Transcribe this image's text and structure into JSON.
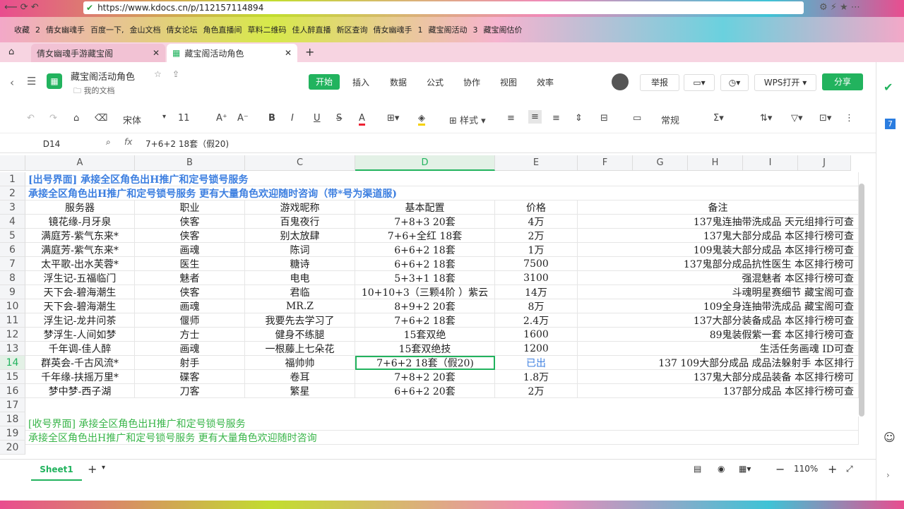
{
  "browser": {
    "url": "https://www.kdocs.cn/p/112157114894",
    "bookmarks": [
      "收藏",
      "2",
      "倩女幽魂手",
      "百度一下,",
      "金山文档",
      "倩女论坛",
      "角色直播间",
      "草料二维码",
      "佳人醉直播",
      "新区查询",
      "倩女幽魂手",
      "1",
      "藏宝阁活动",
      "3",
      "藏宝阁估价"
    ],
    "tabs": [
      {
        "label": "倩女幽魂手游藏宝阁",
        "active": false
      },
      {
        "label": "藏宝阁活动角色",
        "active": true
      }
    ]
  },
  "doc": {
    "title": "藏宝阁活动角色",
    "folder": "我的文档",
    "menu": [
      "开始",
      "插入",
      "数据",
      "公式",
      "协作",
      "视图",
      "效率"
    ],
    "active_menu": "开始",
    "report": "举报",
    "wps_open": "WPS打开",
    "share": "分享"
  },
  "format_toolbar": {
    "font": "宋体",
    "size": "11",
    "style_label": "样式",
    "number_format": "常规"
  },
  "formula_bar": {
    "cell_ref": "D14",
    "fx": "fx",
    "content": "7+6+2 18套（假20)"
  },
  "columns": [
    "A",
    "B",
    "C",
    "D",
    "E",
    "F",
    "G",
    "H",
    "I",
    "J"
  ],
  "rows": [
    "1",
    "2",
    "3",
    "4",
    "5",
    "6",
    "7",
    "8",
    "9",
    "10",
    "11",
    "12",
    "13",
    "14",
    "15",
    "16",
    "17",
    "18",
    "19",
    "20"
  ],
  "sheet": {
    "r1": "[出号界面] 承接全区角色出H推广和定号锁号服务",
    "r2": "承接全区角色出H推广和定号锁号服务 更有大量角色欢迎随时咨询（带*号为渠道服)",
    "header": {
      "a": "服务器",
      "b": "职业",
      "c": "游戏昵称",
      "d": "基本配置",
      "e": "价格",
      "note": "备注"
    },
    "data": [
      {
        "a": "镜花缘-月牙泉",
        "b": "侠客",
        "c": "百鬼夜行",
        "d": "7+8+3 20套",
        "e": "4万",
        "note": "137鬼连抽带洗成品 天元组排行可查"
      },
      {
        "a": "满庭芳-紫气东来*",
        "b": "侠客",
        "c": "别太放肆",
        "d": "7+6+全红 18套",
        "e": "2万",
        "note": "137鬼大部分成品 本区排行榜可查"
      },
      {
        "a": "满庭芳-紫气东来*",
        "b": "画魂",
        "c": "陈词",
        "d": "6+6+2 18套",
        "e": "1万",
        "note": "109鬼装大部分成品 本区排行榜可查"
      },
      {
        "a": "太平歌-出水芙蓉*",
        "b": "医生",
        "c": "糖诗",
        "d": "6+6+2 18套",
        "e": "7500",
        "note": "137鬼部分成品抗性医生 本区排行榜可"
      },
      {
        "a": "浮生记-五福临门",
        "b": "魅者",
        "c": "电电",
        "d": "5+3+1 18套",
        "e": "3100",
        "note": "强混魅者 本区排行榜可查"
      },
      {
        "a": "天下会-碧海潮生",
        "b": "侠客",
        "c": "君临",
        "d": "10+10+3（三颗4阶 ）紫云",
        "e": "14万",
        "note": "斗魂明星赛细节 藏宝阁可查"
      },
      {
        "a": "天下会-碧海潮生",
        "b": "画魂",
        "c": "MR.Z",
        "d": "8+9+2 20套",
        "e": "8万",
        "note": "109全身连抽带洗成品 藏宝阁可查"
      },
      {
        "a": "浮生记-龙井问茶",
        "b": "偃师",
        "c": "我要先去学习了",
        "d": "7+6+2 18套",
        "e": "2.4万",
        "note": "137大部分装备成品 本区排行榜可查"
      },
      {
        "a": "梦浮生-人间如梦",
        "b": "方士",
        "c": "健身不练腿",
        "d": "15套双绝",
        "e": "1600",
        "note": "89鬼装假紫一套 本区排行榜可查"
      },
      {
        "a": "千年调-佳人醉",
        "b": "画魂",
        "c": "一根藤上七朵花",
        "d": "15套双绝技",
        "e": "1200",
        "note": "生活任务画魂 ID可查"
      },
      {
        "a": "群英会-千古风流*",
        "b": "射手",
        "c": "福帅帅",
        "d": "7+6+2 18套（假20)",
        "e": "已出",
        "note": "137 109大部分成品 成品法躲射手 本区排行"
      },
      {
        "a": "千年缘-扶摇万里*",
        "b": "碟客",
        "c": "卷耳",
        "d": "7+8+2 20套",
        "e": "1.8万",
        "note": "137鬼大部分成品装备 本区排行榜可"
      },
      {
        "a": "梦中梦-西子湖",
        "b": "刀客",
        "c": "繁星",
        "d": "6+6+2 20套",
        "e": "2万",
        "note": "137部分成品 本区排行榜可查"
      }
    ],
    "r18": "[收号界面] 承接全区角色出H推广和定号锁号服务",
    "r19": "承接全区角色出H推广和定号锁号服务 更有大量角色欢迎随时咨询"
  },
  "footer": {
    "sheet_tab": "Sheet1",
    "add": "+",
    "zoom": "110%"
  },
  "colors": {
    "accent": "#22b35e",
    "blue_text": "#3d7fe0",
    "green_text": "#39b54a",
    "sold": "#3d7fe0"
  }
}
